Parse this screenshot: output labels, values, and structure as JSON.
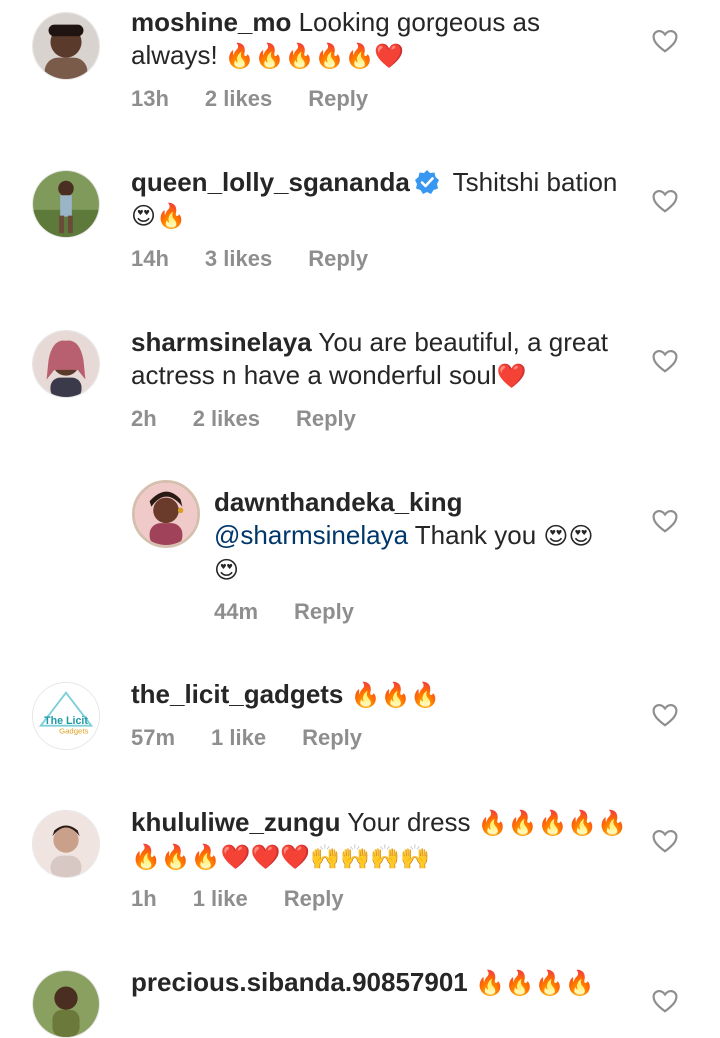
{
  "comments": [
    {
      "username": "moshine_mo",
      "text": " Looking gorgeous as always! ",
      "emoji": "🔥🔥🔥🔥🔥❤️",
      "time": "13h",
      "likes": "2 likes",
      "reply": "Reply",
      "avatar_color": "#7a5a48"
    },
    {
      "username": "queen_lolly_sgananda",
      "text": " Tshitshi bation",
      "emoji": "😍🔥",
      "time": "14h",
      "likes": "3 likes",
      "reply": "Reply",
      "verified": true,
      "avatar_color": "#6d8a4a"
    },
    {
      "username": "sharmsinelaya",
      "text": " You are beautiful, a great actress n have a wonderful soul",
      "emoji": "❤️",
      "time": "2h",
      "likes": "2 likes",
      "reply": "Reply",
      "avatar_color": "#b88a8a"
    },
    {
      "username": "dawnthandeka_king",
      "mention": "@sharmsinelaya",
      "text": " Thank you ",
      "emoji": "😍😍😍",
      "time": "44m",
      "reply": "Reply",
      "is_reply": true,
      "avatar_color": "#a0425a"
    },
    {
      "username": "the_licit_gadgets",
      "text": " ",
      "emoji": "🔥🔥🔥",
      "time": "57m",
      "likes": "1 like",
      "reply": "Reply",
      "logo_text_1": "The Licit",
      "logo_text_2": "Gadgets",
      "avatar_color": "#1f9aa8"
    },
    {
      "username": "khululiwe_zungu",
      "text": " Your dress ",
      "emoji": "🔥🔥🔥🔥🔥🔥🔥🔥❤️❤️❤️🙌🙌🙌🙌",
      "time": "1h",
      "likes": "1 like",
      "reply": "Reply",
      "avatar_color": "#c9a08a"
    },
    {
      "username": "precious.sibanda.90857901",
      "text": " ",
      "emoji": "🔥🔥🔥🔥",
      "avatar_color": "#6b7a3a"
    }
  ],
  "colors": {
    "meta": "#8e8e8e",
    "mention": "#00376b",
    "verified": "#3897f0"
  },
  "icons": {
    "like": "heart-outline-icon",
    "verified": "verified-badge-icon"
  }
}
